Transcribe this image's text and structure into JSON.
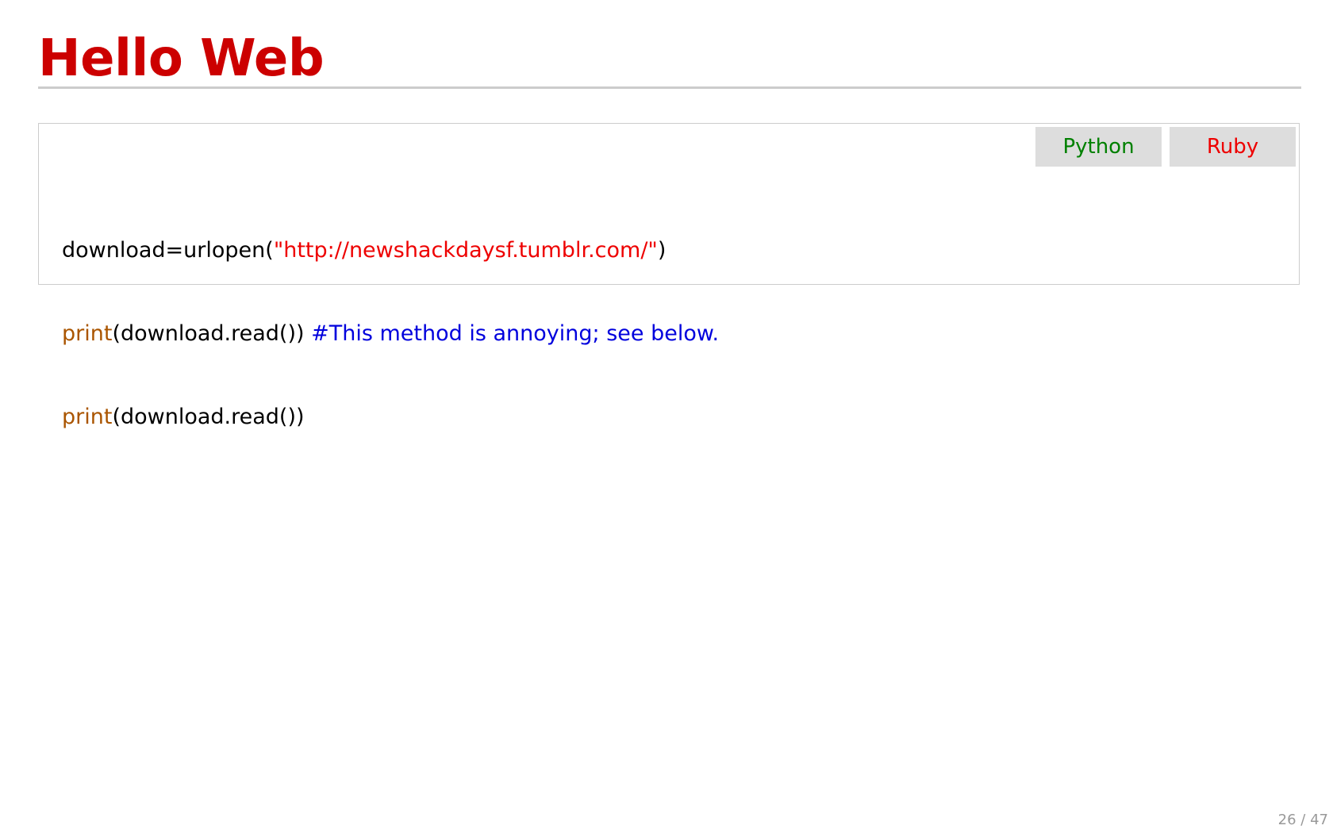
{
  "slide": {
    "title": "Hello Web",
    "title_color": "#cc0000"
  },
  "code_panel": {
    "tabs": [
      {
        "label": "Python",
        "color": "#008000"
      },
      {
        "label": "Ruby",
        "color": "#ee0000"
      }
    ],
    "lines": [
      [
        {
          "text": "download=urlopen(",
          "kind": "plain"
        },
        {
          "text": "\"http://newshackdaysf.tumblr.com/\"",
          "kind": "string"
        },
        {
          "text": ")",
          "kind": "plain"
        }
      ],
      [
        {
          "text": "print",
          "kind": "keyword"
        },
        {
          "text": "(download.read()) ",
          "kind": "plain"
        },
        {
          "text": "#This method is annoying; see below.",
          "kind": "comment"
        }
      ],
      [
        {
          "text": "print",
          "kind": "keyword"
        },
        {
          "text": "(download.read())",
          "kind": "plain"
        }
      ]
    ],
    "token_colors": {
      "plain": "#000000",
      "string": "#ee0000",
      "keyword": "#aa5500",
      "comment": "#0000dd"
    }
  },
  "footer": {
    "page_counter": "26 / 47"
  }
}
